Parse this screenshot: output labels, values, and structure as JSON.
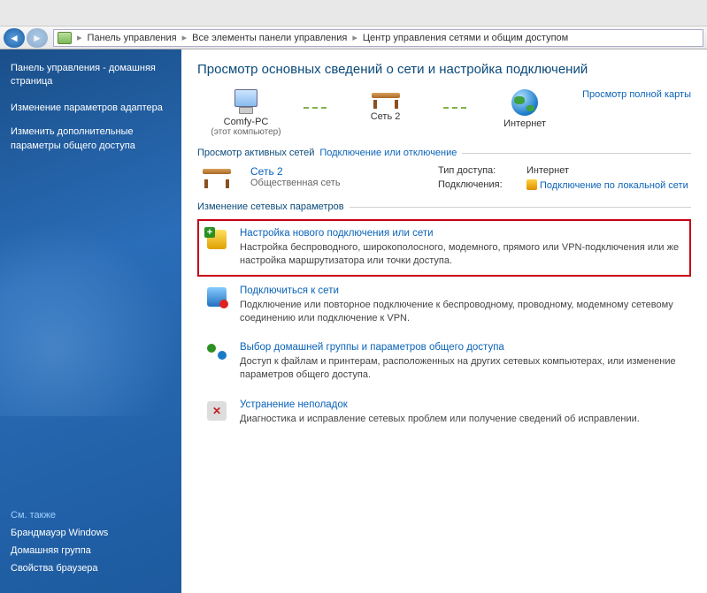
{
  "address": {
    "path": [
      "Панель управления",
      "Все элементы панели управления",
      "Центр управления сетями и общим доступом"
    ]
  },
  "sidebar": {
    "title": "Панель управления - домашняя страница",
    "links": [
      "Изменение параметров адаптера",
      "Изменить дополнительные параметры общего доступа"
    ],
    "footer_title": "См. также",
    "footer_links": [
      "Брандмауэр Windows",
      "Домашняя группа",
      "Свойства браузера"
    ]
  },
  "content": {
    "page_title": "Просмотр основных сведений о сети и настройка подключений",
    "map": {
      "node_local": "Comfy-PC",
      "node_local_sub": "(этот компьютер)",
      "node_network": "Сеть 2",
      "node_internet": "Интернет",
      "full_map_link": "Просмотр полной карты"
    },
    "active_section": "Просмотр активных сетей",
    "connect_link": "Подключение или отключение",
    "active_network": {
      "name": "Сеть 2",
      "type": "Общественная сеть",
      "access_label": "Тип доступа:",
      "access_value": "Интернет",
      "conn_label": "Подключения:",
      "conn_value": "Подключение по локальной сети"
    },
    "change_section": "Изменение сетевых параметров",
    "tasks": [
      {
        "title": "Настройка нового подключения или сети",
        "desc": "Настройка беспроводного, широкополосного, модемного, прямого или VPN-подключения или же настройка маршрутизатора или точки доступа.",
        "highlight": true
      },
      {
        "title": "Подключиться к сети",
        "desc": "Подключение или повторное подключение к беспроводному, проводному, модемному сетевому соединению или подключение к VPN.",
        "highlight": false
      },
      {
        "title": "Выбор домашней группы и параметров общего доступа",
        "desc": "Доступ к файлам и принтерам, расположенных на других сетевых компьютерах, или изменение параметров общего доступа.",
        "highlight": false
      },
      {
        "title": "Устранение неполадок",
        "desc": "Диагностика и исправление сетевых проблем или получение сведений об исправлении.",
        "highlight": false
      }
    ]
  }
}
